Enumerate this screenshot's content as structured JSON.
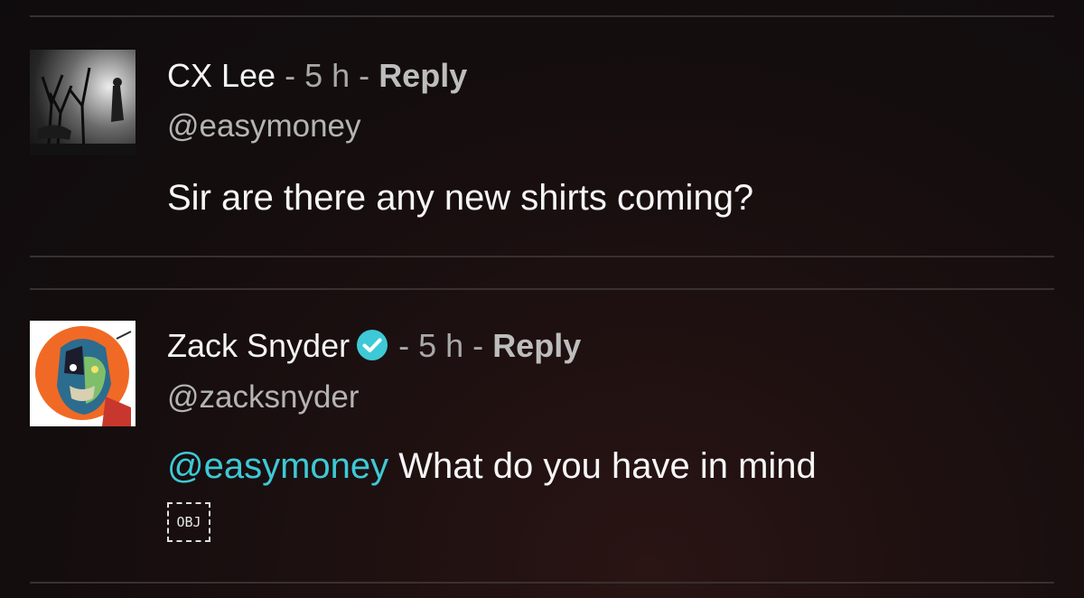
{
  "comments": [
    {
      "author": "CX Lee",
      "separator": "-",
      "time": "5 h",
      "reply_label": "Reply",
      "handle": "@easymoney",
      "text": "Sir are there any new shirts coming?"
    },
    {
      "author": "Zack Snyder",
      "verified": true,
      "separator": "-",
      "time": "5 h",
      "reply_label": "Reply",
      "handle": "@zacksnyder",
      "mention": "@easymoney",
      "text": "What do you have in mind",
      "badge": "OBJ"
    }
  ],
  "colors": {
    "mention": "#3ec9d6",
    "verified_badge": "#3ec9d6"
  }
}
